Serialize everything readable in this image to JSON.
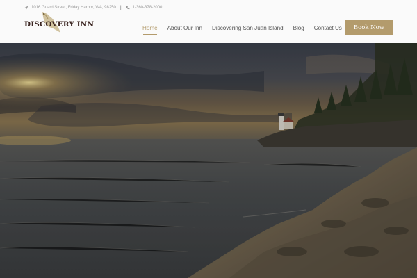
{
  "header": {
    "address": "1016 Guard Street, Friday Harbor, WA, 98250",
    "phone": "1-360-378-2000",
    "logo_text": "DISCOVERY INN",
    "nav": [
      {
        "label": "Home",
        "active": true
      },
      {
        "label": "About Our Inn",
        "active": false
      },
      {
        "label": "Discovering San Juan Island",
        "active": false
      },
      {
        "label": "Blog",
        "active": false
      },
      {
        "label": "Contact Us",
        "active": false
      }
    ],
    "book_now": "Book Now"
  },
  "colors": {
    "accent": "#b39b6c",
    "logo": "#3a2420",
    "header_bg": "#fafafa"
  },
  "hero": {
    "subject": "sunset over sea with lighthouse on rocky shore"
  }
}
